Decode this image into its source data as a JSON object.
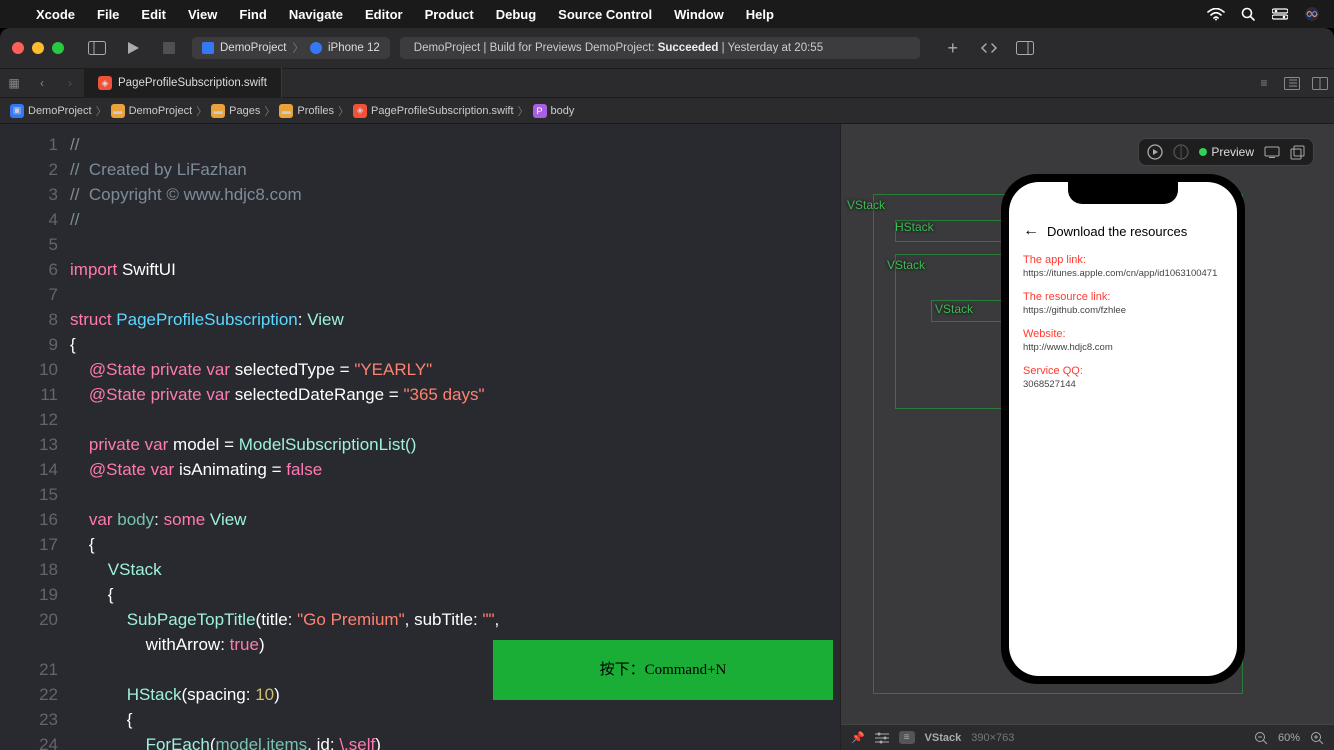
{
  "menubar": {
    "app": "Xcode",
    "items": [
      "File",
      "Edit",
      "View",
      "Find",
      "Navigate",
      "Editor",
      "Product",
      "Debug",
      "Source Control",
      "Window",
      "Help"
    ]
  },
  "toolbar": {
    "scheme_project": "DemoProject",
    "scheme_device": "iPhone 12",
    "status_prefix": "DemoProject | Build for Previews DemoProject: ",
    "status_result": "Succeeded",
    "status_time": " | Yesterday at 20:55"
  },
  "tabs": {
    "file": "PageProfileSubscription.swift"
  },
  "breadcrumb": [
    "DemoProject",
    "DemoProject",
    "Pages",
    "Profiles",
    "PageProfileSubscription.swift",
    "body"
  ],
  "code": {
    "line1": "//",
    "line2a": "//  Created by LiFazhan",
    "line3a": "//  Copyright © www.hdjc8.com",
    "line4": "//",
    "import_kw": "import",
    "import_mod": "SwiftUI",
    "struct_kw": "struct",
    "struct_name": "PageProfileSubscription",
    "view_type": "View",
    "state_kw": "@State",
    "private_kw": "private",
    "var_kw": "var",
    "sel_type": "selectedType",
    "yearly": "\"YEARLY\"",
    "sel_range": "selectedDateRange",
    "days": "\"365 days\"",
    "model_var": "model",
    "model_init": "ModelSubscriptionList()",
    "anim_var": "isAnimating",
    "false_kw": "false",
    "body_var": "body",
    "some_kw": "some",
    "vstack": "VStack",
    "subpage": "SubPageTopTitle",
    "title_arg": "title:",
    "title_val": "\"Go Premium\"",
    "sub_arg": "subTitle:",
    "sub_val": "\"\"",
    "arrow_arg": "withArrow:",
    "true_kw": "true",
    "hstack": "HStack",
    "spacing_arg": "spacing:",
    "spacing_val": "10",
    "foreach": "ForEach",
    "items_expr": "model.items",
    "id_arg": "id:",
    "self_expr": "\\.self"
  },
  "hint": "按下：Command+N",
  "annotations": {
    "vstack1": "VStack",
    "hstack": "HStack",
    "vstack2": "VStack",
    "vstack3": "VStack"
  },
  "preview": {
    "label": "Preview",
    "phone_title": "Download the resources",
    "blocks": [
      {
        "title": "The app link:",
        "url": "https://itunes.apple.com/cn/app/id1063100471"
      },
      {
        "title": "The resource link:",
        "url": "https://github.com/fzhlee"
      },
      {
        "title": "Website:",
        "url": "http://www.hdjc8.com"
      },
      {
        "title": "Service QQ:",
        "url": "3068527144"
      }
    ],
    "bottom_sel": "VStack",
    "bottom_dim": "390×763",
    "zoom": "60%"
  }
}
